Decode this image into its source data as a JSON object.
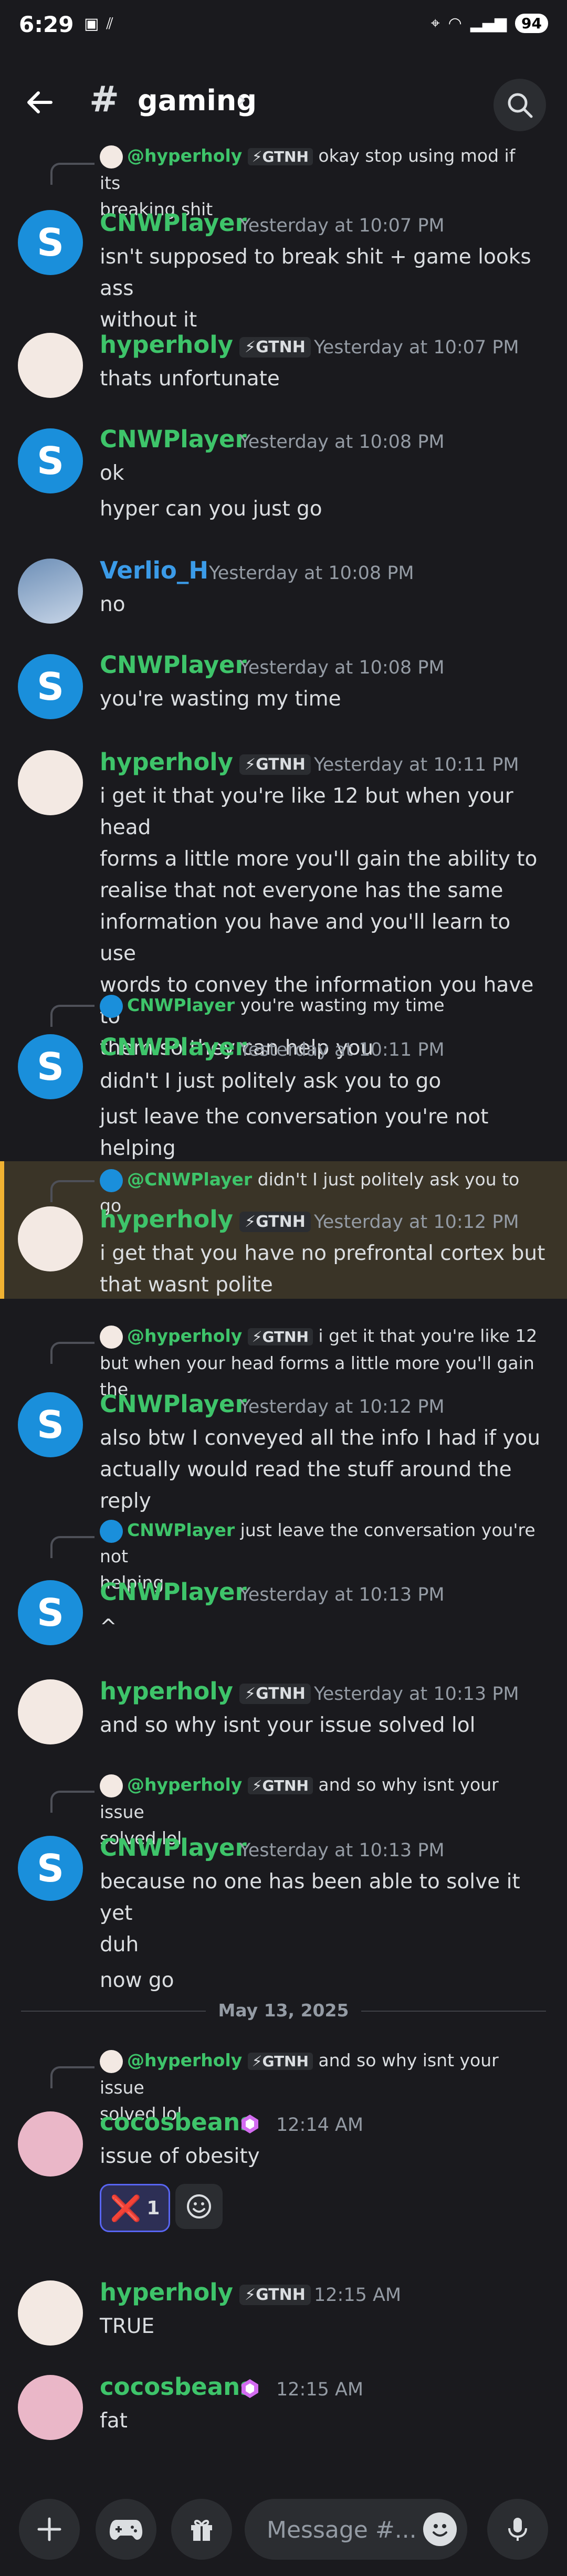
{
  "status_bar": {
    "time": "6:29",
    "battery": "94"
  },
  "header": {
    "channel_name": "gaming",
    "back_icon": "arrow-left-icon",
    "search_icon": "search-icon"
  },
  "messages": [
    {
      "reply": {
        "name": "@hyperholy",
        "tag": "GTNH",
        "text": "okay stop using mod if its",
        "text2": "breaking shit"
      },
      "author": "CNWPlayer",
      "time": "Yesterday at 10:07 PM",
      "lines": [
        "isn't supposed to break shit + game looks ass",
        "without it"
      ]
    },
    {
      "author": "hyperholy",
      "tag": "GTNH",
      "time": "Yesterday at 10:07 PM",
      "lines": [
        "thats unfortunate"
      ]
    },
    {
      "author": "CNWPlayer",
      "time": "Yesterday at 10:08 PM",
      "lines": [
        "ok",
        "hyper can you just go"
      ]
    },
    {
      "author": "Verlio_H",
      "time": "Yesterday at 10:08 PM",
      "lines": [
        "no"
      ]
    },
    {
      "author": "CNWPlayer",
      "time": "Yesterday at 10:08 PM",
      "lines": [
        "you're wasting my time"
      ]
    },
    {
      "author": "hyperholy",
      "tag": "GTNH",
      "time": "Yesterday at 10:11 PM",
      "lines": [
        "i get it that you're like 12 but when your head",
        "forms a little more you'll gain the ability to",
        "realise that not everyone has the same",
        "information you have and you'll learn to use",
        "words to convey the information you have to",
        "them so they can help you"
      ]
    },
    {
      "reply": {
        "name": "CNWPlayer",
        "text": "you're wasting my time"
      },
      "author": "CNWPlayer",
      "time": "Yesterday at 10:11 PM",
      "lines": [
        "didn't I just politely ask you to go",
        "just leave the conversation you're not helping"
      ]
    },
    {
      "reply": {
        "name": "@CNWPlayer",
        "text": "didn't I just politely ask you to go"
      },
      "author": "hyperholy",
      "tag": "GTNH",
      "time": "Yesterday at 10:12 PM",
      "lines": [
        "i get that you have no prefrontal cortex but",
        "that wasnt polite"
      ]
    },
    {
      "reply": {
        "name": "@hyperholy",
        "tag": "GTNH",
        "text": "i get it that you're like 12",
        "text2": "but when your head forms a little more you'll gain the"
      },
      "author": "CNWPlayer",
      "time": "Yesterday at 10:12 PM",
      "lines": [
        "also btw I conveyed all the info I had if you",
        "actually would read the stuff around the reply"
      ]
    },
    {
      "reply": {
        "name": "CNWPlayer",
        "text": "just leave the conversation you're not",
        "text2": "helping"
      },
      "author": "CNWPlayer",
      "time": "Yesterday at 10:13 PM",
      "lines": [
        "^"
      ]
    },
    {
      "author": "hyperholy",
      "tag": "GTNH",
      "time": "Yesterday at 10:13 PM",
      "lines": [
        "and so why isnt your issue solved lol"
      ]
    },
    {
      "reply": {
        "name": "@hyperholy",
        "tag": "GTNH",
        "text": "and so why isnt your issue",
        "text2": "solved lol"
      },
      "author": "CNWPlayer",
      "time": "Yesterday at 10:13 PM",
      "lines": [
        "because no one has been able to solve it yet",
        "duh",
        "now go"
      ]
    },
    {
      "reply": {
        "name": "@hyperholy",
        "tag": "GTNH",
        "text": "and so why isnt your issue",
        "text2": "solved lol"
      },
      "author": "cocosbeans",
      "time": "12:14 AM",
      "lines": [
        "issue of obesity"
      ],
      "reaction": {
        "emoji": "❌",
        "count": "1"
      }
    },
    {
      "author": "hyperholy",
      "tag": "GTNH",
      "time": "12:15 AM",
      "lines": [
        "TRUE"
      ]
    },
    {
      "author": "cocosbeans",
      "time": "12:15 AM",
      "lines": [
        "fat"
      ]
    }
  ],
  "date_divider": "May 13, 2025",
  "composer": {
    "placeholder": "Message #..."
  },
  "colors": {
    "accent_green": "#3ec46a",
    "accent_blue": "#3b9be8",
    "highlight": "#f0b232",
    "background": "#1a1a1e"
  }
}
